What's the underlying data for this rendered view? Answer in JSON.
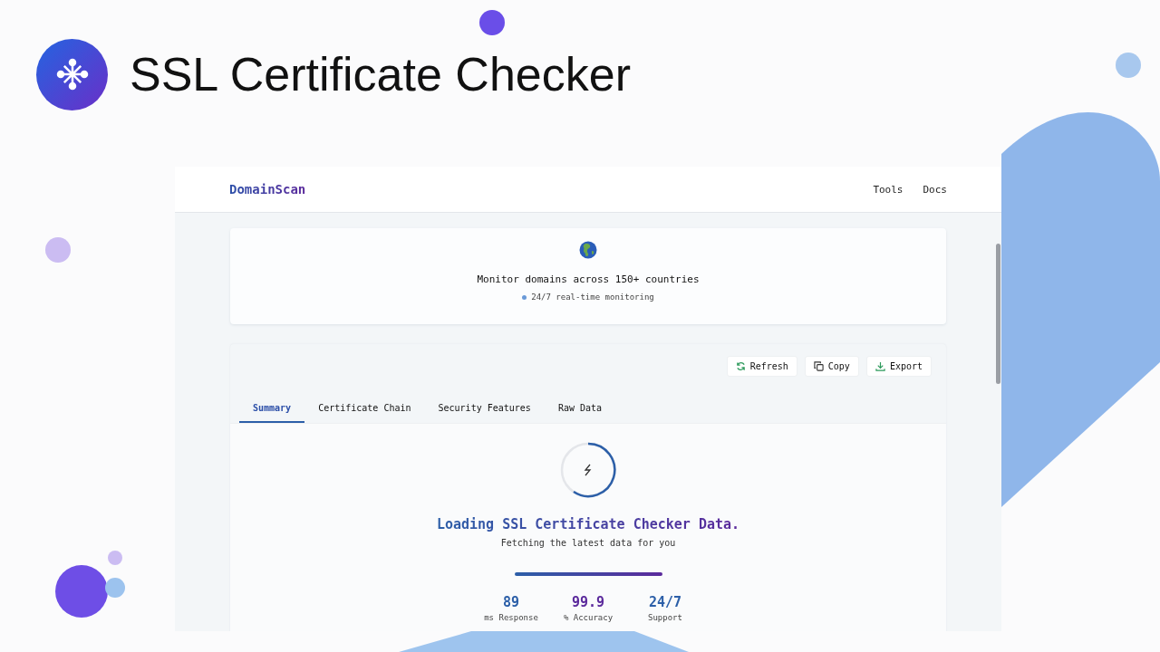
{
  "header": {
    "title": "SSL Certificate Checker"
  },
  "site": {
    "brand": "DomainScan",
    "nav": [
      {
        "label": "Tools"
      },
      {
        "label": "Docs"
      }
    ]
  },
  "banner": {
    "headline": "Monitor domains across 150+ countries",
    "note": "24/7 real-time monitoring"
  },
  "toolbar": [
    {
      "label": "Refresh",
      "kind": "refresh"
    },
    {
      "label": "Copy",
      "kind": "copy"
    },
    {
      "label": "Export",
      "kind": "export"
    }
  ],
  "tabs": [
    {
      "label": "Summary",
      "selected": true
    },
    {
      "label": "Certificate Chain",
      "selected": false
    },
    {
      "label": "Security Features",
      "selected": false
    },
    {
      "label": "Raw Data",
      "selected": false
    }
  ],
  "loading": {
    "title": "Loading SSL Certificate Checker Data.",
    "subtitle": "Fetching the latest data for you",
    "stats": [
      {
        "value": "89",
        "label": "ms Response",
        "color": "#2c5fa8"
      },
      {
        "value": "99.9",
        "label": "% Accuracy",
        "color": "#5b2a9c"
      },
      {
        "value": "24/7",
        "label": "Support",
        "color": "#2c5fa8"
      }
    ]
  }
}
